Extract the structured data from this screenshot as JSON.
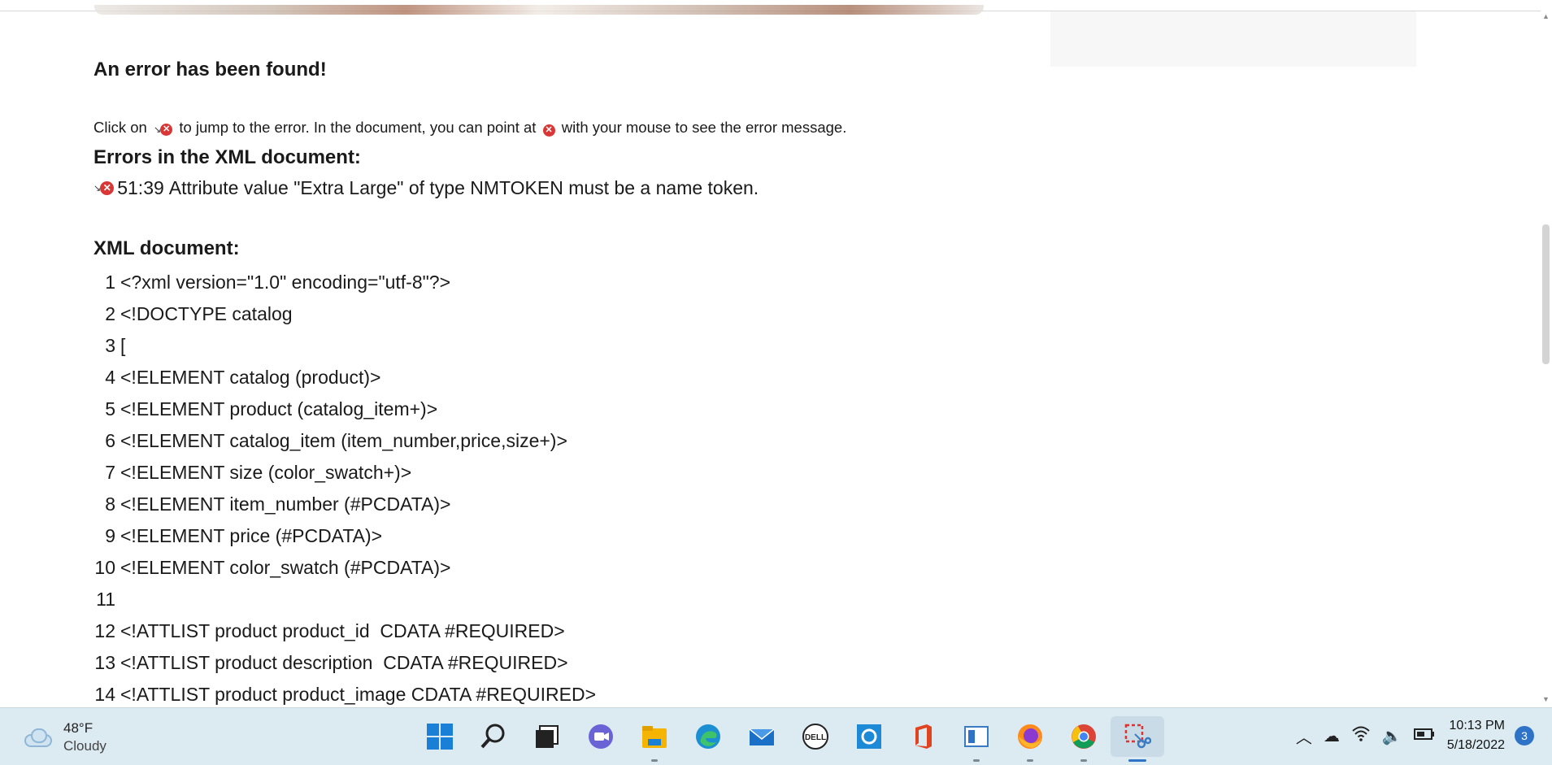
{
  "page": {
    "heading_error": "An error has been found!",
    "hint_before": "Click on",
    "hint_middle": "to jump to the error. In the document, you can point at",
    "hint_after": "with your mouse to see the error message.",
    "heading_errors": "Errors in the XML document:",
    "error": {
      "location": "51:39",
      "message": "Attribute value \"Extra Large\" of type NMTOKEN must be a name token."
    },
    "heading_xml": "XML document:",
    "code_lines": [
      {
        "n": "1",
        "text": "<?xml version=\"1.0\" encoding=\"utf-8\"?>"
      },
      {
        "n": "2",
        "text": "<!DOCTYPE catalog"
      },
      {
        "n": "3",
        "text": "["
      },
      {
        "n": "4",
        "text": "<!ELEMENT catalog (product)>"
      },
      {
        "n": "5",
        "text": "<!ELEMENT product (catalog_item+)>"
      },
      {
        "n": "6",
        "text": "<!ELEMENT catalog_item (item_number,price,size+)>"
      },
      {
        "n": "7",
        "text": "<!ELEMENT size (color_swatch+)>"
      },
      {
        "n": "8",
        "text": "<!ELEMENT item_number (#PCDATA)>"
      },
      {
        "n": "9",
        "text": "<!ELEMENT price (#PCDATA)>"
      },
      {
        "n": "10",
        "text": "<!ELEMENT color_swatch (#PCDATA)>"
      },
      {
        "n": "11",
        "text": ""
      },
      {
        "n": "12",
        "text": "<!ATTLIST product product_id  CDATA #REQUIRED>"
      },
      {
        "n": "13",
        "text": "<!ATTLIST product description  CDATA #REQUIRED>"
      },
      {
        "n": "14",
        "text": "<!ATTLIST product product_image CDATA #REQUIRED>"
      }
    ],
    "icons": {
      "jump": "jump-to-error-icon",
      "error": "error-x-icon"
    },
    "colors": {
      "error_red": "#d93636"
    }
  },
  "taskbar": {
    "weather_temp": "48°F",
    "weather_cond": "Cloudy",
    "apps": [
      {
        "name": "start-icon"
      },
      {
        "name": "search-icon"
      },
      {
        "name": "task-view-icon"
      },
      {
        "name": "teams-chat-icon"
      },
      {
        "name": "file-explorer-icon"
      },
      {
        "name": "edge-icon"
      },
      {
        "name": "mail-icon"
      },
      {
        "name": "dell-icon"
      },
      {
        "name": "cortana-icon"
      },
      {
        "name": "office-icon"
      },
      {
        "name": "notepad-icon"
      },
      {
        "name": "firefox-icon"
      },
      {
        "name": "chrome-icon"
      },
      {
        "name": "snipping-tool-icon"
      }
    ],
    "time": "10:13 PM",
    "date": "5/18/2022",
    "notifications": "3"
  }
}
